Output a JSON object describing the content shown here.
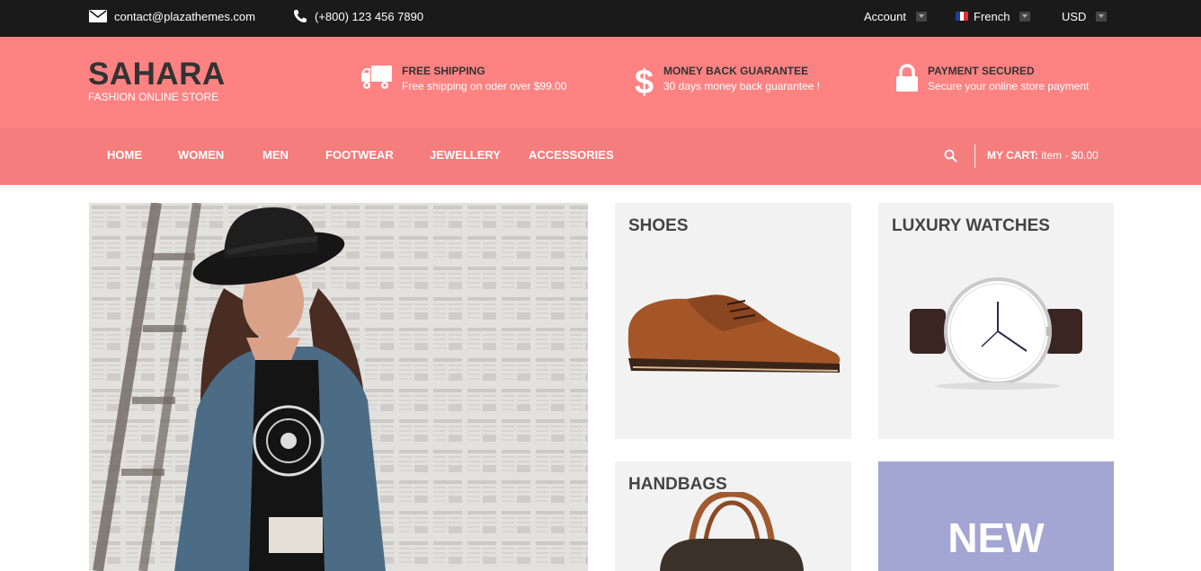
{
  "topbar": {
    "email": "contact@plazathemes.com",
    "phone": "(+800) 123 456 7890",
    "account_label": "Account",
    "language_label": "French",
    "currency_label": "USD"
  },
  "header": {
    "logo_title": "SAHARA",
    "logo_subtitle": "FASHION ONLINE STORE",
    "features": [
      {
        "title": "FREE SHIPPING",
        "text": "Free shipping on oder over $99.00",
        "icon": "truck-icon"
      },
      {
        "title": "MONEY BACK GUARANTEE",
        "text": "30 days money back guarantee !",
        "icon": "dollar-icon"
      },
      {
        "title": "PAYMENT SECURED",
        "text": "Secure your online store payment",
        "icon": "lock-icon"
      }
    ]
  },
  "nav": {
    "items": [
      "HOME",
      "WOMEN",
      "MEN",
      "FOOTWEAR",
      "JEWELLERY",
      "ACCESSORIES"
    ],
    "cart_label": "MY CART:",
    "cart_value": "item - $0.00"
  },
  "categories": {
    "shoes": "SHOES",
    "watches": "LUXURY WATCHES",
    "handbags": "HANDBAGS",
    "new": "NEW"
  },
  "colors": {
    "topbar": "#1a1a1a",
    "header": "#ff8282",
    "nav": "#f57d7d",
    "new_tile": "#a3a5d2"
  }
}
